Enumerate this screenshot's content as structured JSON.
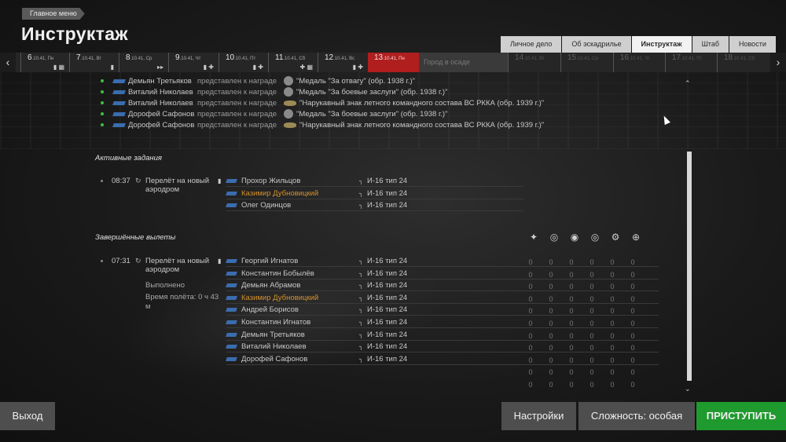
{
  "header": {
    "main_menu": "Главное меню",
    "title": "Инструктаж"
  },
  "tabs": [
    {
      "label": "Личное дело"
    },
    {
      "label": "Об эскадрилье"
    },
    {
      "label": "Инструктаж"
    },
    {
      "label": "Штаб"
    },
    {
      "label": "Новости"
    }
  ],
  "timeline": {
    "days": [
      {
        "num": "6",
        "sub": ".10.41, Пн",
        "icon": "▮ ▦"
      },
      {
        "num": "7",
        "sub": ".10.41, Вт",
        "icon": "▮"
      },
      {
        "num": "8",
        "sub": ".10.41, Ср",
        "icon": "▸▸"
      },
      {
        "num": "9",
        "sub": ".10.41, Чт",
        "icon": "▮ ✚"
      },
      {
        "num": "10",
        "sub": ".10.41, Пт",
        "icon": "▮ ✚"
      },
      {
        "num": "11",
        "sub": ".10.41, Сб",
        "icon": "✚ ▦"
      },
      {
        "num": "12",
        "sub": ".10.41, Вс",
        "icon": "▮ ✚"
      },
      {
        "num": "13",
        "sub": ".10.41, Пн",
        "icon": ""
      },
      {
        "num": "14",
        "sub": ".10.41, Вт",
        "icon": ""
      },
      {
        "num": "15",
        "sub": ".10.41, Ср",
        "icon": ""
      },
      {
        "num": "16",
        "sub": ".10.41, Чт",
        "icon": ""
      },
      {
        "num": "17",
        "sub": ".10.41, Пт",
        "icon": ""
      },
      {
        "num": "18",
        "sub": ".10.41, Сб",
        "icon": ""
      }
    ],
    "event": "Город в осаде"
  },
  "awards": [
    {
      "name": "Демьян Третьяков",
      "text": "представлен к награде",
      "award": "\"Медаль \"За отвагу\" (обр. 1938 г.)\""
    },
    {
      "name": "Виталий Николаев",
      "text": "представлен к награде",
      "award": "\"Медаль \"За боевые заслуги\" (обр. 1938 г.)\""
    },
    {
      "name": "Виталий Николаев",
      "text": "представлен к награде",
      "award": "\"Нарукавный знак летного командного состава ВС РККА (обр. 1939 г.)\""
    },
    {
      "name": "Дорофей Сафонов",
      "text": "представлен к награде",
      "award": "\"Медаль \"За боевые заслуги\" (обр. 1938 г.)\""
    },
    {
      "name": "Дорофей Сафонов",
      "text": "представлен к награде",
      "award": "\"Нарукавный знак летного командного состава ВС РККА (обр. 1939 г.)\""
    }
  ],
  "active": {
    "title": "Активные задания",
    "time": "08:37",
    "mission": "Перелёт на новый аэродром",
    "pilots": [
      {
        "name": "Прохор Жильцов",
        "plane": "И-16 тип 24"
      },
      {
        "name": "Казимир Дубновицкий",
        "plane": "И-16 тип 24"
      },
      {
        "name": "Олег Одинцов",
        "plane": "И-16 тип 24"
      }
    ]
  },
  "completed": {
    "title": "Завершённые вылеты",
    "time": "07:31",
    "mission": "Перелёт на новый аэродром",
    "status": "Выполнено",
    "flight_time": "Время полёта: 0 ч 43 м",
    "pilots": [
      {
        "name": "Георгий Игнатов",
        "plane": "И-16 тип 24"
      },
      {
        "name": "Константин Бобылёв",
        "plane": "И-16 тип 24"
      },
      {
        "name": "Демьян Абрамов",
        "plane": "И-16 тип 24"
      },
      {
        "name": "Казимир Дубновицкий",
        "plane": "И-16 тип 24"
      },
      {
        "name": "Андрей Борисов",
        "plane": "И-16 тип 24"
      },
      {
        "name": "Константин Игнатов",
        "plane": "И-16 тип 24"
      },
      {
        "name": "Демьян Третьяков",
        "plane": "И-16 тип 24"
      },
      {
        "name": "Виталий Николаев",
        "plane": "И-16 тип 24"
      },
      {
        "name": "Дорофей Сафонов",
        "plane": "И-16 тип 24"
      }
    ],
    "stat_icons": [
      "plane-kill-icon",
      "ground-target-icon",
      "vehicle-target-icon",
      "artillery-target-icon",
      "ship-target-icon",
      "crosshair-icon"
    ],
    "stats": [
      [
        "0",
        "0",
        "0",
        "0",
        "0",
        "0"
      ],
      [
        "0",
        "0",
        "0",
        "0",
        "0",
        "0"
      ],
      [
        "0",
        "0",
        "0",
        "0",
        "0",
        "0"
      ],
      [
        "0",
        "0",
        "0",
        "0",
        "0",
        "0"
      ],
      [
        "0",
        "0",
        "0",
        "0",
        "0",
        "0"
      ],
      [
        "0",
        "0",
        "0",
        "0",
        "0",
        "0"
      ],
      [
        "0",
        "0",
        "0",
        "0",
        "0",
        "0"
      ],
      [
        "0",
        "0",
        "0",
        "0",
        "0",
        "0"
      ],
      [
        "0",
        "0",
        "0",
        "0",
        "0",
        "0"
      ],
      [
        "0",
        "0",
        "0",
        "0",
        "0",
        "0"
      ],
      [
        "0",
        "0",
        "0",
        "0",
        "0",
        "0"
      ]
    ]
  },
  "buttons": {
    "exit": "Выход",
    "settings": "Настройки",
    "difficulty": "Сложность: особая",
    "start": "ПРИСТУПИТЬ"
  }
}
